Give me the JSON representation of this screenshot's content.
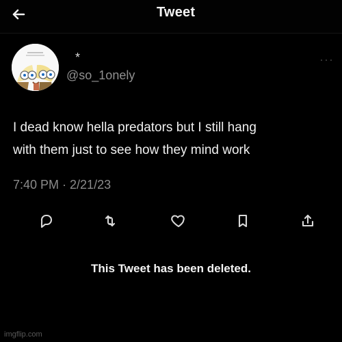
{
  "header": {
    "back_icon": "arrow-left-icon",
    "title": "Tweet"
  },
  "tweet": {
    "more_icon": "more-horizontal-icon",
    "avatar_icon": "cartoon-avatar-icon",
    "display_name": "*",
    "handle": "@so_1onely",
    "text_lines": [
      "I dead know hella predators but I still hang",
      "with them just to see how they mind work"
    ],
    "meta": "7:40 PM · 2/21/23",
    "actions": {
      "reply_icon": "reply-icon",
      "retweet_icon": "retweet-icon",
      "like_icon": "heart-icon",
      "bookmark_icon": "bookmark-icon",
      "share_icon": "share-icon"
    }
  },
  "notice": "This Tweet has been deleted.",
  "watermark": "imgflip.com",
  "colors": {
    "background": "#000000",
    "primary_text": "#f0f0f0",
    "secondary_text": "#8b8b8b"
  }
}
